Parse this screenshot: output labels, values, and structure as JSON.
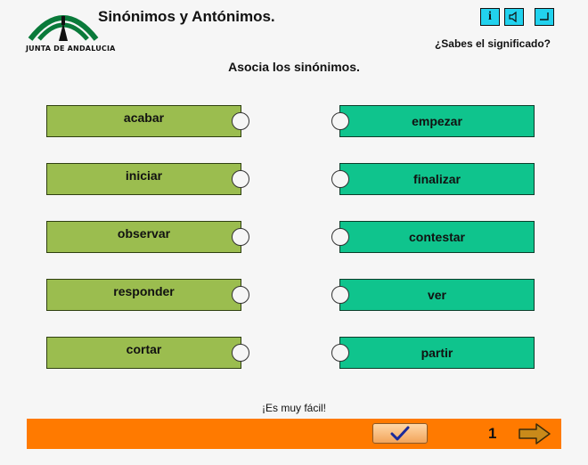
{
  "header": {
    "logo_text": "JUNTA DE ANDALUCIA",
    "title": "Sinónimos y Antónimos.",
    "subtitle": "¿Sabes el significado?",
    "buttons": [
      {
        "label": "i",
        "icon": "info-icon"
      },
      {
        "icon": "speaker-icon"
      },
      {
        "icon": "exit-icon"
      }
    ]
  },
  "instruction": "Asocia los sinónimos.",
  "left_words": [
    "acabar",
    "iniciar",
    "observar",
    "responder",
    "cortar"
  ],
  "right_words": [
    "empezar",
    "finalizar",
    "contestar",
    "ver",
    "partir"
  ],
  "hint": "¡Es muy fácil!",
  "footer": {
    "check_icon": "checkmark-icon",
    "page": "1",
    "next_icon": "arrow-right-icon"
  },
  "colors": {
    "left_tile": "#9bbd4f",
    "right_tile": "#0fc48d",
    "bar": "#ff7a00",
    "top_buttons": "#22d2ee"
  }
}
